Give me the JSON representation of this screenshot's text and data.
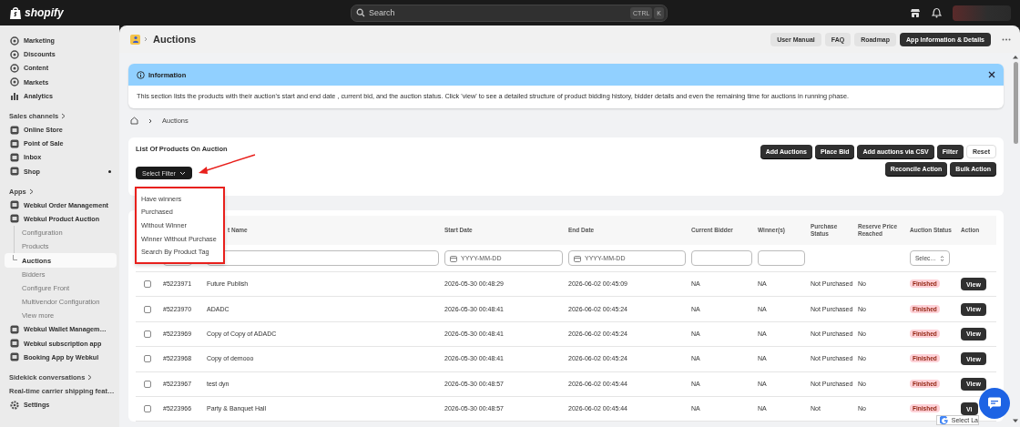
{
  "topbar": {
    "logo": "shopify",
    "search": {
      "placeholder": "Search",
      "shortcut": [
        "CTRL",
        "K"
      ]
    }
  },
  "sidebar": {
    "groups": [
      {
        "items": [
          {
            "label": "Marketing"
          },
          {
            "label": "Discounts"
          },
          {
            "label": "Content"
          },
          {
            "label": "Markets"
          },
          {
            "label": "Analytics"
          }
        ]
      },
      {
        "heading": "Sales channels",
        "items": [
          {
            "label": "Online Store"
          },
          {
            "label": "Point of Sale"
          },
          {
            "label": "Inbox"
          },
          {
            "label": "Shop",
            "dot": true
          }
        ]
      },
      {
        "heading": "Apps",
        "items": [
          {
            "label": "Webkul Order Management"
          },
          {
            "label": "Webkul Product Auction",
            "expanded": true,
            "children": [
              {
                "label": "Configuration",
                "selected": false
              },
              {
                "label": "Products",
                "selected": false
              },
              {
                "label": "Auctions",
                "selected": true
              },
              {
                "label": "Bidders",
                "selected": false
              },
              {
                "label": "Configure Front",
                "selected": false
              },
              {
                "label": "Multivendor Configuration",
                "selected": false
              },
              {
                "label": "View more",
                "selected": false
              }
            ]
          },
          {
            "label": "Webkul Wallet Managem…"
          },
          {
            "label": "Webkul subscription app"
          },
          {
            "label": "Booking App by Webkul"
          }
        ]
      },
      {
        "heading": "Sidekick conversations",
        "items": [
          {
            "label": "Real-time carrier shipping feat…",
            "kind": "plain"
          },
          {
            "label": "Settings"
          }
        ]
      }
    ]
  },
  "page": {
    "title": "Auctions",
    "buttons": [
      {
        "label": "User Manual",
        "kind": "secondary"
      },
      {
        "label": "FAQ",
        "kind": "secondary"
      },
      {
        "label": "Roadmap",
        "kind": "secondary"
      },
      {
        "label": "App Information & Details",
        "kind": "primary"
      }
    ]
  },
  "info": {
    "title": "Information",
    "text": "This section lists the products with their auction's start and end date , current bid, and the auction status. Click 'view' to see a detailed structure of product bidding history, bidder details and even the remaining time for auctions in running phase."
  },
  "breadcrumb": [
    "Auctions"
  ],
  "list": {
    "title": "List Of Products On Auction",
    "actions": [
      [
        {
          "label": "Add Auctions",
          "kind": "primary"
        },
        {
          "label": "Place Bid",
          "kind": "primary"
        },
        {
          "label": "Add auctions via CSV",
          "kind": "primary"
        },
        {
          "label": "Filter",
          "kind": "primary"
        },
        {
          "label": "Reset",
          "kind": "plain"
        }
      ],
      [
        {
          "label": "Reconcile Action",
          "kind": "primary"
        },
        {
          "label": "Bulk Action",
          "kind": "primary"
        }
      ]
    ],
    "filter": {
      "label": "Select Filter",
      "expanded": true,
      "options": [
        "Have winners",
        "Purchased",
        "Without Winner",
        "Winner Without Purchase",
        "Search By Product Tag"
      ]
    }
  },
  "table": {
    "columns": [
      {
        "filter": {
          "kind": "text"
        }
      },
      {
        "label": "t Name",
        "filter": {
          "kind": "text"
        }
      },
      {
        "label": "Start Date",
        "filter": {
          "kind": "date",
          "placeholder": "YYYY-MM-DD"
        }
      },
      {
        "label": "End Date",
        "filter": {
          "kind": "date",
          "placeholder": "YYYY-MM-DD"
        }
      },
      {
        "label": "Current Bidder",
        "filter": {
          "kind": "text"
        }
      },
      {
        "label": "Winner(s)",
        "filter": {
          "kind": "text"
        }
      },
      {
        "label": "Purchase Status"
      },
      {
        "label": "Reserve Price Reached"
      },
      {
        "label": "Auction Status",
        "filter": {
          "kind": "select",
          "placeholder": "Selec…"
        }
      },
      {
        "label": "Action"
      }
    ],
    "rows": [
      {
        "checked": false,
        "id": "#5223971",
        "name": "Future Publish",
        "start": "2026-05-30 00:48:29",
        "end": "2026-06-02 00:45:09",
        "bidder": "NA",
        "winner": "NA",
        "purchase": "Not Purchased",
        "reserve": "No",
        "status": "Finished",
        "action": "View"
      },
      {
        "checked": false,
        "id": "#5223970",
        "name": "ADADC",
        "start": "2026-05-30 00:48:41",
        "end": "2026-06-02 00:45:24",
        "bidder": "NA",
        "winner": "NA",
        "purchase": "Not Purchased",
        "reserve": "No",
        "status": "Finished",
        "action": "View"
      },
      {
        "checked": false,
        "id": "#5223969",
        "name": "Copy of Copy of ADADC",
        "start": "2026-05-30 00:48:41",
        "end": "2026-06-02 00:45:24",
        "bidder": "NA",
        "winner": "NA",
        "purchase": "Not Purchased",
        "reserve": "No",
        "status": "Finished",
        "action": "View"
      },
      {
        "checked": false,
        "id": "#5223968",
        "name": "Copy of demooo",
        "start": "2026-05-30 00:48:41",
        "end": "2026-06-02 00:45:24",
        "bidder": "NA",
        "winner": "NA",
        "purchase": "Not Purchased",
        "reserve": "No",
        "status": "Finished",
        "action": "View"
      },
      {
        "checked": false,
        "id": "#5223967",
        "name": "test dyn",
        "start": "2026-05-30 00:48:57",
        "end": "2026-06-02 00:45:44",
        "bidder": "NA",
        "winner": "NA",
        "purchase": "Not Purchased",
        "reserve": "No",
        "status": "Finished",
        "action": "View"
      },
      {
        "checked": false,
        "id": "#5223966",
        "name": "Party & Banquet Hall",
        "start": "2026-05-30 00:48:57",
        "end": "2026-06-02 00:45:44",
        "bidder": "NA",
        "winner": "NA",
        "purchase": "Not",
        "reserve": "No",
        "status": "Finished",
        "action": "Vi"
      }
    ]
  },
  "translate": {
    "label": "Select La"
  }
}
